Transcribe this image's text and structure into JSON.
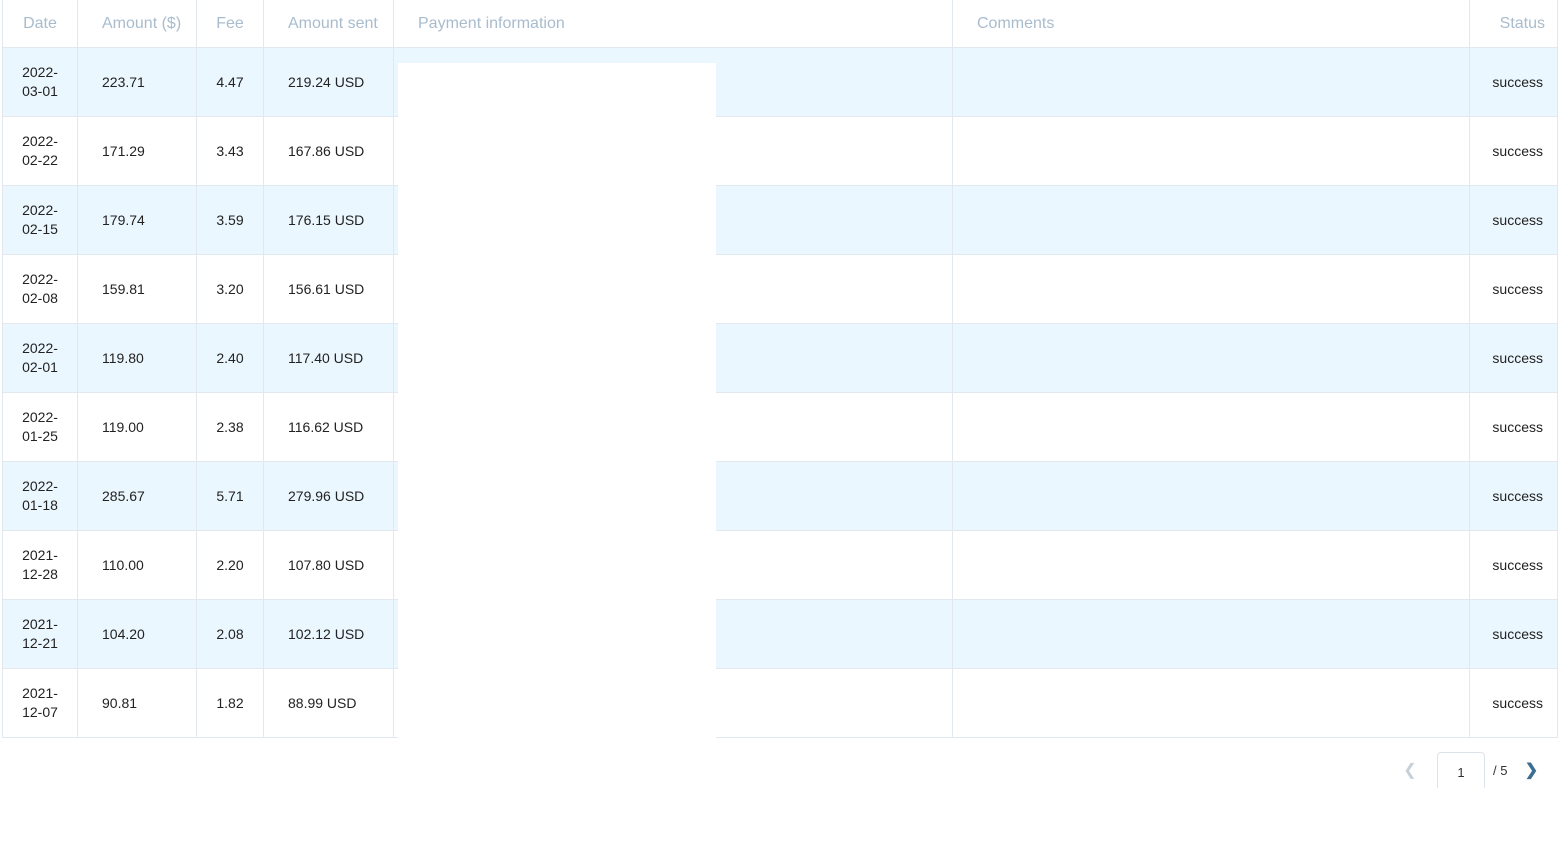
{
  "table": {
    "headers": {
      "date": "Date",
      "amount": "Amount ($)",
      "fee": "Fee",
      "amount_sent": "Amount sent",
      "payment_info": "Payment information",
      "comments": "Comments",
      "status": "Status"
    },
    "rows": [
      {
        "date_y": "2022-",
        "date_md": "03-01",
        "amount": "223.71",
        "fee": "4.47",
        "amount_sent": "219.24 USD",
        "payment_info": "",
        "comments": "",
        "status": "success"
      },
      {
        "date_y": "2022-",
        "date_md": "02-22",
        "amount": "171.29",
        "fee": "3.43",
        "amount_sent": "167.86 USD",
        "payment_info": "",
        "comments": "",
        "status": "success"
      },
      {
        "date_y": "2022-",
        "date_md": "02-15",
        "amount": "179.74",
        "fee": "3.59",
        "amount_sent": "176.15 USD",
        "payment_info": "",
        "comments": "",
        "status": "success"
      },
      {
        "date_y": "2022-",
        "date_md": "02-08",
        "amount": "159.81",
        "fee": "3.20",
        "amount_sent": "156.61 USD",
        "payment_info": "",
        "comments": "",
        "status": "success"
      },
      {
        "date_y": "2022-",
        "date_md": "02-01",
        "amount": "119.80",
        "fee": "2.40",
        "amount_sent": "117.40 USD",
        "payment_info": "",
        "comments": "",
        "status": "success"
      },
      {
        "date_y": "2022-",
        "date_md": "01-25",
        "amount": "119.00",
        "fee": "2.38",
        "amount_sent": "116.62 USD",
        "payment_info": "",
        "comments": "",
        "status": "success"
      },
      {
        "date_y": "2022-",
        "date_md": "01-18",
        "amount": "285.67",
        "fee": "5.71",
        "amount_sent": "279.96 USD",
        "payment_info": "",
        "comments": "",
        "status": "success"
      },
      {
        "date_y": "2021-",
        "date_md": "12-28",
        "amount": "110.00",
        "fee": "2.20",
        "amount_sent": "107.80 USD",
        "payment_info": "",
        "comments": "",
        "status": "success"
      },
      {
        "date_y": "2021-",
        "date_md": "12-21",
        "amount": "104.20",
        "fee": "2.08",
        "amount_sent": "102.12 USD",
        "payment_info": "",
        "comments": "",
        "status": "success"
      },
      {
        "date_y": "2021-",
        "date_md": "12-07",
        "amount": "90.81",
        "fee": "1.82",
        "amount_sent": "88.99 USD",
        "payment_info": "",
        "comments": "",
        "status": "success"
      }
    ]
  },
  "pagination": {
    "prev_icon": "chevron-left-icon",
    "next_icon": "chevron-right-icon",
    "current_page": "1",
    "total_label": "/ 5"
  },
  "colors": {
    "header_text": "#a9bccd",
    "row_stripe": "#ebf7fe",
    "border": "#e3e8ee"
  }
}
